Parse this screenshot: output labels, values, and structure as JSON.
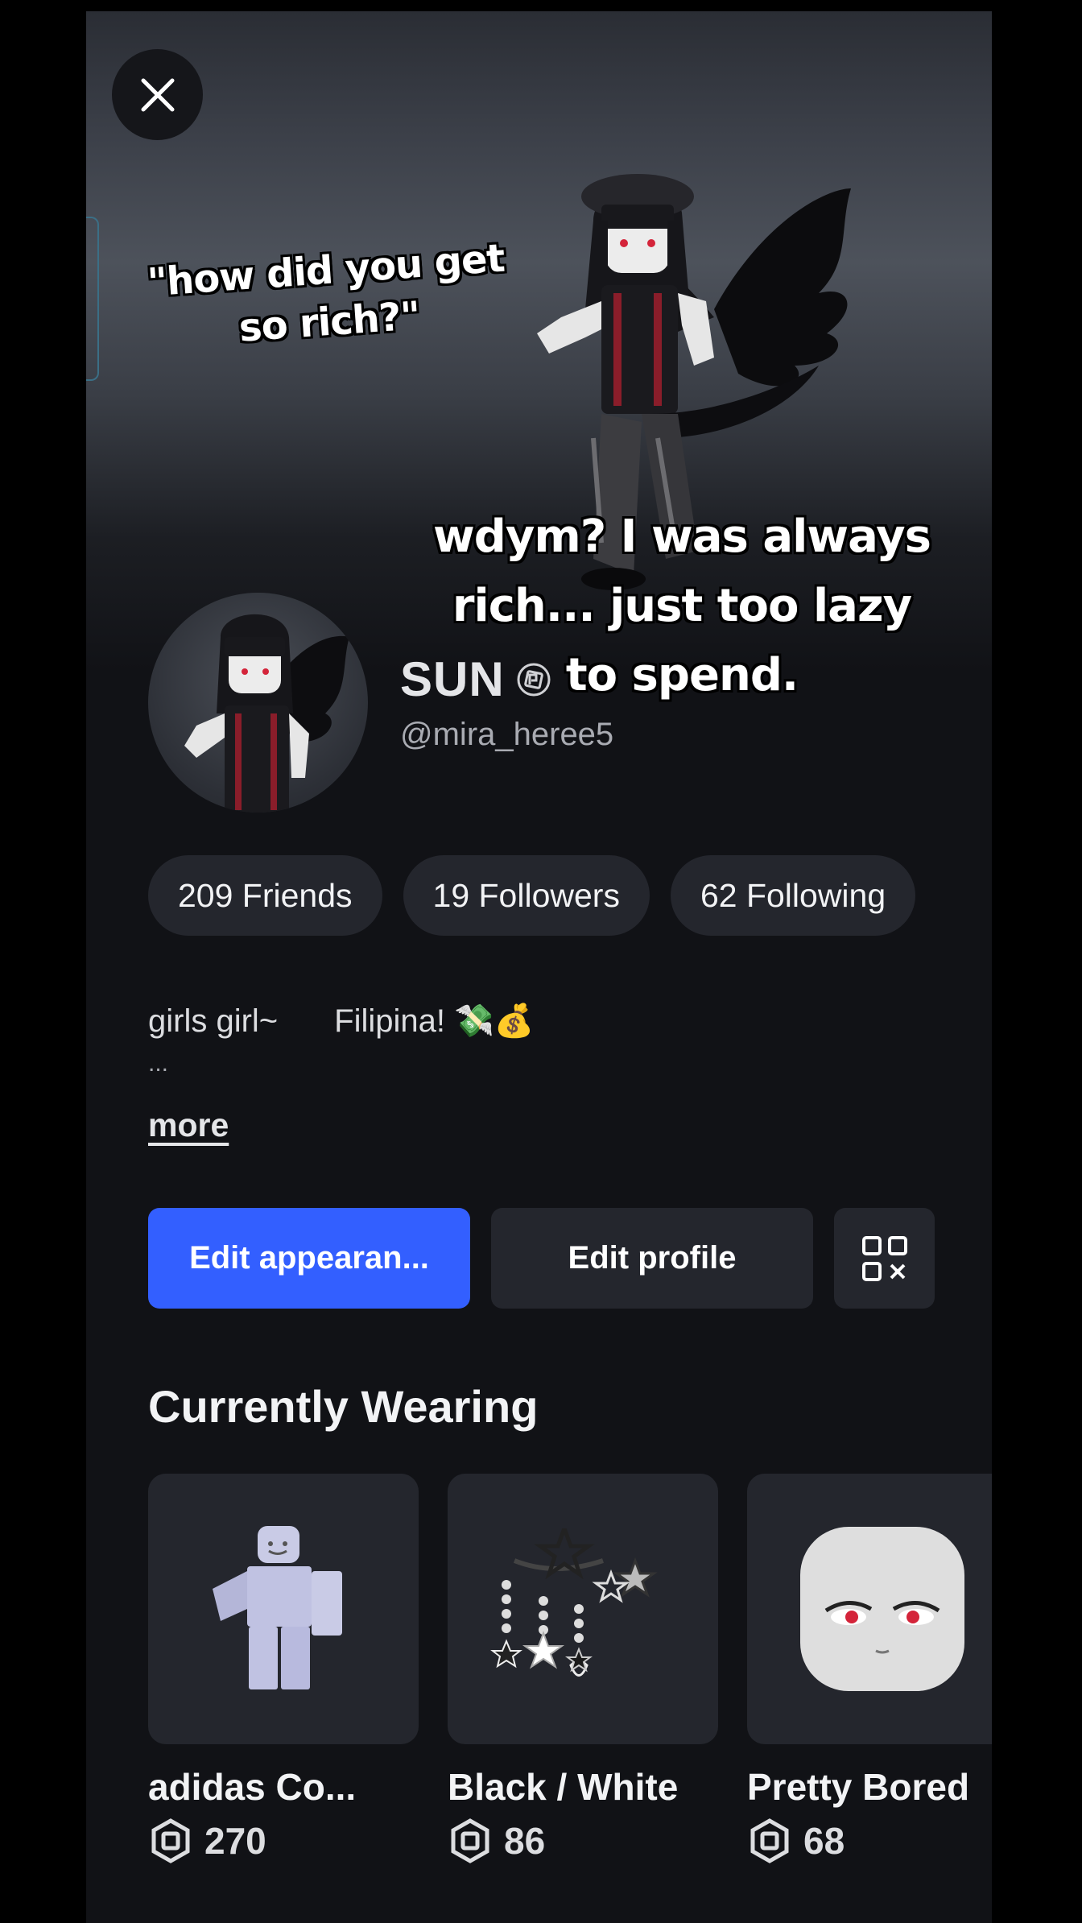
{
  "captions": {
    "top": "\"how did you get so rich?\"",
    "bottom": "wdym? I was always rich... just too lazy to spend."
  },
  "profile": {
    "display_name": "SUN",
    "username": "@mira_heree5"
  },
  "stats": {
    "friends": "209 Friends",
    "followers": "19 Followers",
    "following": "62 Following"
  },
  "bio": {
    "part1": "girls girl~",
    "part2": "Filipina! 💸💰",
    "ellipsis": "...",
    "more_label": "more"
  },
  "actions": {
    "edit_appearance": "Edit appearan...",
    "edit_profile": "Edit profile"
  },
  "wearing": {
    "title": "Currently Wearing",
    "items": [
      {
        "name": "adidas Co...",
        "price": "270"
      },
      {
        "name": "Black / White",
        "price": "86"
      },
      {
        "name": "Pretty Bored",
        "price": "68"
      }
    ]
  },
  "colors": {
    "primary_button": "#335fff",
    "background": "#111216",
    "pill_background": "#24262d"
  },
  "icons": {
    "close": "close-icon",
    "verified": "verified-badge-icon",
    "qr": "qr-code-icon",
    "currency": "robux-icon"
  }
}
